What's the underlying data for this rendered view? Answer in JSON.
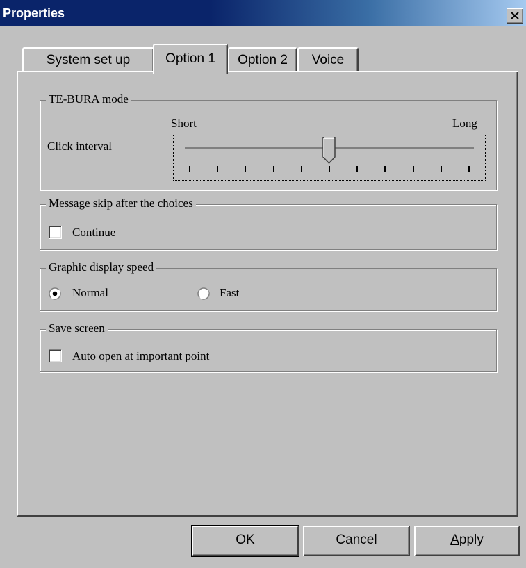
{
  "window": {
    "title": "Properties",
    "close_glyph": "close-icon"
  },
  "tabs": [
    {
      "label": "System set up",
      "active": false
    },
    {
      "label": "Option 1",
      "active": true
    },
    {
      "label": "Option 2",
      "active": false
    },
    {
      "label": "Voice",
      "active": false
    }
  ],
  "te_bura": {
    "legend": "TE-BURA mode",
    "field_label": "Click interval",
    "min_label": "Short",
    "max_label": "Long",
    "slider_value": 0.5,
    "tick_count": 11
  },
  "message_skip": {
    "legend": "Message skip after the choices",
    "checkbox_label": "Continue",
    "checked": false
  },
  "graphic_speed": {
    "legend": "Graphic display speed",
    "options": [
      "Normal",
      "Fast"
    ],
    "selected": "Normal"
  },
  "save_screen": {
    "legend": "Save screen",
    "checkbox_label": "Auto open at important point",
    "checked": false
  },
  "buttons": {
    "ok": "OK",
    "cancel": "Cancel",
    "apply": "Apply"
  },
  "colors": {
    "face": "#c0c0c0",
    "title_start": "#0a246a",
    "title_end": "#a6caf0"
  }
}
